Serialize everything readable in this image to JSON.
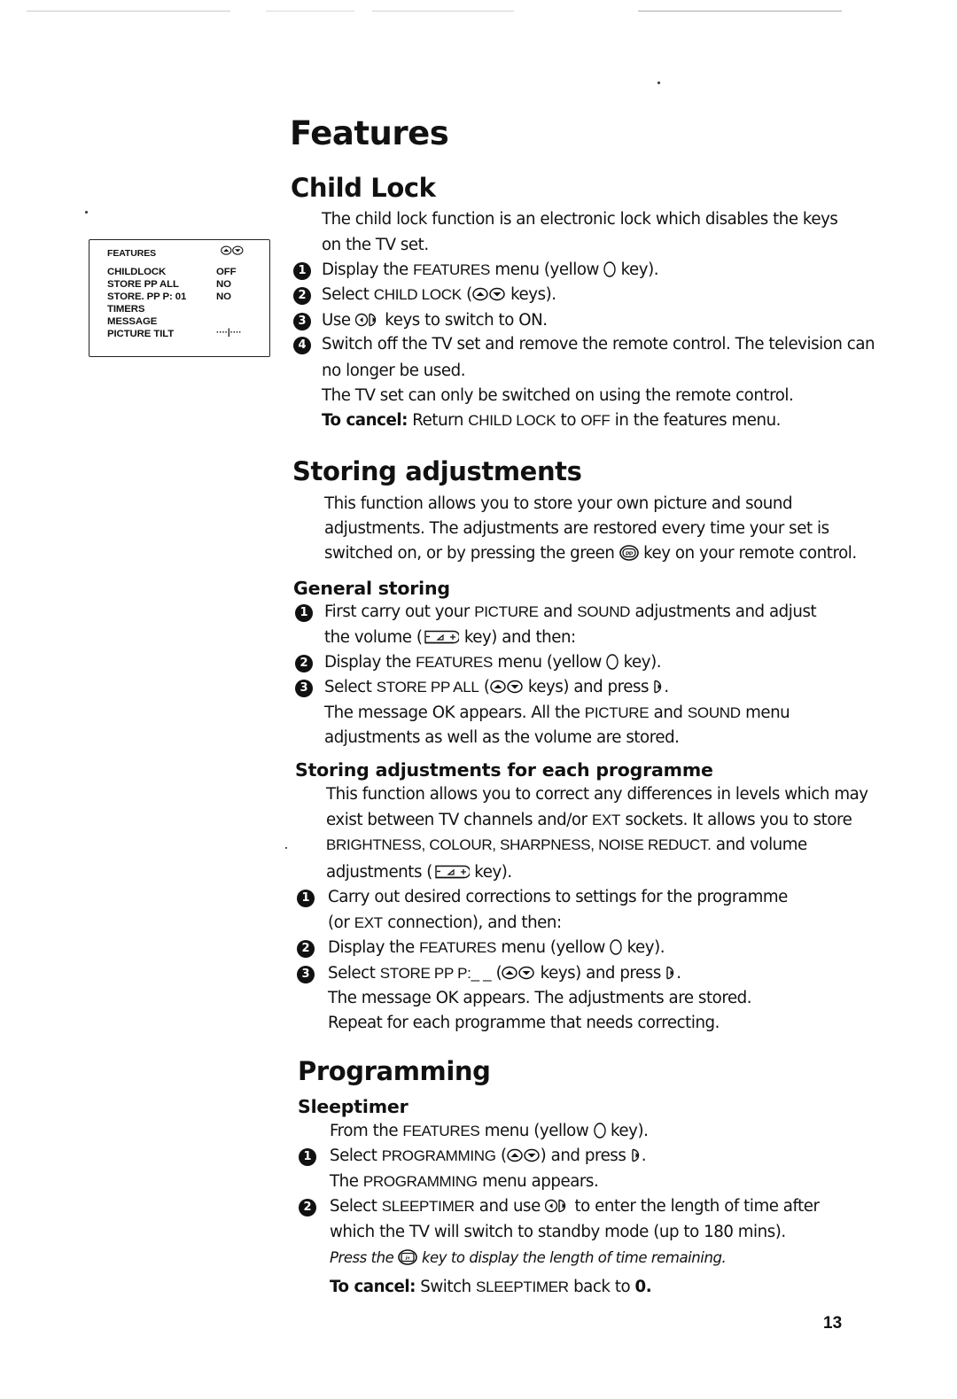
{
  "page_title": "Features",
  "page_number": "13",
  "menu_screen": {
    "title": "FEATURES",
    "nav_icon": "up-down-keys-icon",
    "rows": [
      {
        "label": "CHILDLOCK",
        "value": "OFF"
      },
      {
        "label": "STORE PP ALL",
        "value": "NO"
      },
      {
        "label": "STORE. PP P: 01",
        "value": "NO"
      },
      {
        "label": "TIMERS",
        "value": ""
      },
      {
        "label": "MESSAGE",
        "value": ""
      },
      {
        "label": "PICTURE TILT",
        "value": "····|····"
      }
    ]
  },
  "child_lock": {
    "heading": "Child Lock",
    "intro_1": "The child lock function is an electronic lock which disables the keys",
    "intro_2": "on the TV set.",
    "steps": [
      {
        "n": "1",
        "pre": "Display the ",
        "caps": "FEATURES",
        "post": " menu (yellow ",
        "post2": " key)."
      },
      {
        "n": "2",
        "pre": "Select ",
        "caps": "CHILD LOCK",
        "post": " (",
        "post2": " keys)."
      },
      {
        "n": "3",
        "pre": "Use ",
        "post": " keys to switch to ON."
      },
      {
        "n": "4",
        "line1": "Switch off the TV set and remove the remote control. The television can",
        "line2": "no longer be used."
      }
    ],
    "note": "The TV set can only be switched on using the remote control.",
    "cancel_label": "To cancel:",
    "cancel_pre": " Return ",
    "cancel_caps": "CHILD LOCK",
    "cancel_mid": " to ",
    "cancel_caps2": "OFF",
    "cancel_post": " in the features menu."
  },
  "storing": {
    "heading": "Storing adjustments",
    "intro_1": "This function allows you to store your own picture and sound",
    "intro_2": "adjustments. The adjustments are restored every time your set is",
    "intro_3a": "switched on, or by pressing the green ",
    "intro_3b": " key on your remote control.",
    "general": {
      "heading": "General storing",
      "s1_a": "First carry out your ",
      "s1_caps1": "PICTURE",
      "s1_b": " and ",
      "s1_caps2": "SOUND",
      "s1_c": " adjustments and adjust",
      "s1_line2a": "the volume (",
      "s1_line2b": " key) and then:",
      "s2_a": "Display the ",
      "s2_caps": "FEATURES",
      "s2_b": " menu (yellow ",
      "s2_c": " key).",
      "s3_a": "Select ",
      "s3_caps": "STORE PP ALL",
      "s3_b": " (",
      "s3_c": " keys) and press ",
      "s3_d": ".",
      "after_1a": "The message OK appears. All the ",
      "after_1caps": "PICTURE",
      "after_1b": " and ",
      "after_1caps2": "SOUND",
      "after_1c": " menu",
      "after_2": "adjustments as well as the volume are stored."
    },
    "per_programme": {
      "heading": "Storing adjustments for each programme",
      "intro_1": "This function allows you to correct any differences in levels which may",
      "intro_2a": "exist between TV channels and/or ",
      "intro_2caps": "EXT",
      "intro_2b": " sockets. It allows you to store",
      "intro_3caps": "BRIGHTNESS, COLOUR, SHARPNESS, NOISE REDUCT.",
      "intro_3b": " and volume",
      "intro_4a": "adjustments (",
      "intro_4b": " key).",
      "s1_line1": "Carry out desired corrections to settings for the programme",
      "s1_line2a": "(or ",
      "s1_line2caps": "EXT",
      "s1_line2b": " connection), and then:",
      "s2_a": "Display the ",
      "s2_caps": "FEATURES",
      "s2_b": " menu (yellow ",
      "s2_c": " key).",
      "s3_a": "Select ",
      "s3_caps": "STORE PP P:_ _",
      "s3_b": " (",
      "s3_c": " keys) and press ",
      "s3_d": ".",
      "after_1": "The message OK appears. The adjustments are stored.",
      "after_2": "Repeat for each programme that needs correcting."
    }
  },
  "programming": {
    "heading": "Programming",
    "sleeptimer": {
      "heading": "Sleeptimer",
      "intro_a": "From the ",
      "intro_caps": "FEATURES",
      "intro_b": " menu (yellow ",
      "intro_c": " key).",
      "s1_a": "Select ",
      "s1_caps": "PROGRAMMING",
      "s1_b": " (",
      "s1_c": ") and press ",
      "s1_d": ".",
      "s1_after_a": "The ",
      "s1_after_caps": "PROGRAMMING",
      "s1_after_b": " menu appears.",
      "s2_a": "Select ",
      "s2_caps": "SLEEPTIMER",
      "s2_b": " and use ",
      "s2_c": " to enter the length of time after",
      "s2_line2": "which the TV will switch to standby mode (up to 180 mins).",
      "tip_a": "Press the ",
      "tip_b": " key to display the length of time remaining.",
      "cancel_label": "To cancel:",
      "cancel_a": " Switch ",
      "cancel_caps": "SLEEPTIMER",
      "cancel_b": " back to ",
      "cancel_value": "0."
    }
  }
}
